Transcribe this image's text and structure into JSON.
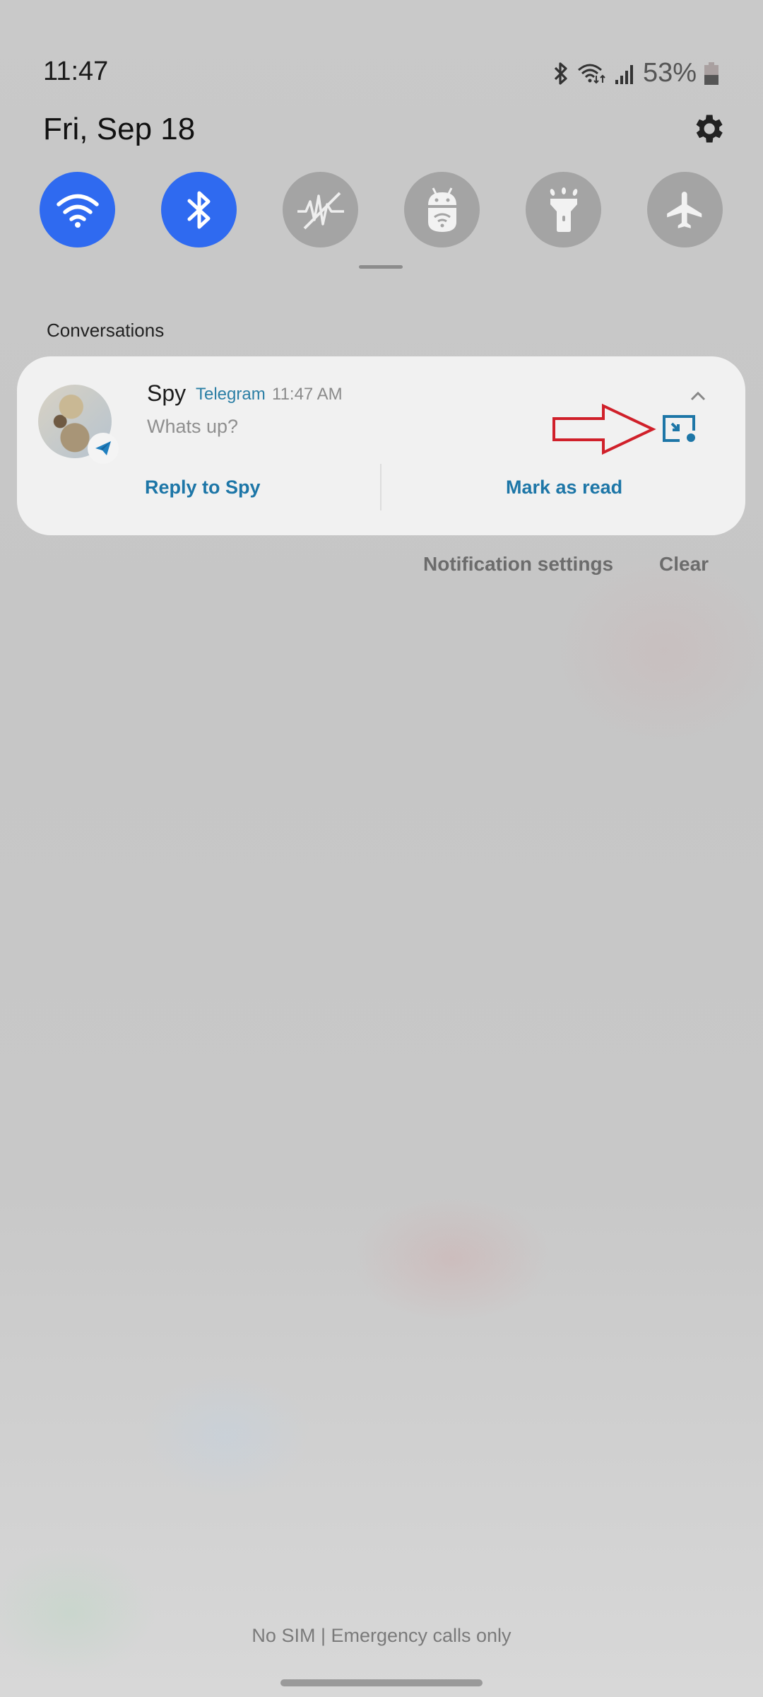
{
  "status_bar": {
    "time": "11:47",
    "battery_percent": "53%",
    "battery_level": 0.53,
    "icons": [
      "bluetooth-icon",
      "wifi-data-icon",
      "signal-icon",
      "battery-icon"
    ]
  },
  "header": {
    "date": "Fri, Sep 18",
    "settings_icon": "gear-icon"
  },
  "quick_settings": [
    {
      "name": "Wi-Fi",
      "icon": "wifi-icon",
      "state": "on"
    },
    {
      "name": "Bluetooth",
      "icon": "bluetooth-icon",
      "state": "on"
    },
    {
      "name": "Sound",
      "icon": "vibrate-off-icon",
      "state": "off"
    },
    {
      "name": "Android hotspot",
      "icon": "android-wifi-icon",
      "state": "off"
    },
    {
      "name": "Flashlight",
      "icon": "flashlight-icon",
      "state": "off"
    },
    {
      "name": "Airplane mode",
      "icon": "airplane-icon",
      "state": "off"
    }
  ],
  "notifications": {
    "section_title": "Conversations",
    "items": [
      {
        "sender": "Spy",
        "app": "Telegram",
        "time": "11:47 AM",
        "message": "Whats up?",
        "actions": [
          "Reply to Spy",
          "Mark as read"
        ]
      }
    ],
    "footer": {
      "settings_label": "Notification settings",
      "clear_label": "Clear"
    }
  },
  "colors": {
    "accent_blue": "#2f6af0",
    "action_blue": "#1d76a7",
    "annotation_red": "#d0202a"
  },
  "carrier_text": "No SIM | Emergency calls only"
}
